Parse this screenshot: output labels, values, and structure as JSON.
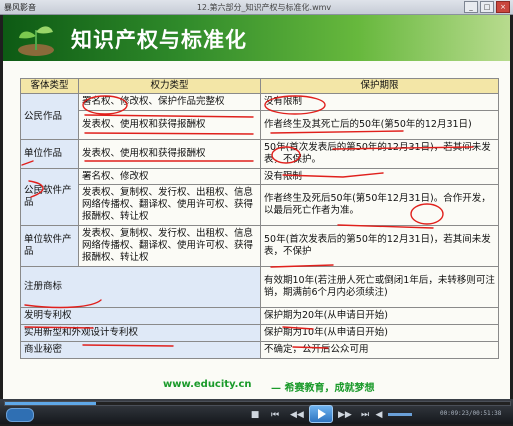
{
  "window": {
    "app_name": "暴风影音",
    "title": "12.第六部分_知识产权与标准化.wmv",
    "buttons": [
      "_",
      "□",
      "×"
    ]
  },
  "slide": {
    "title": "知识产权与标准化",
    "table": {
      "headers": [
        "客体类型",
        "权力类型",
        "保护期限"
      ],
      "rows": {
        "gongmin_1": {
          "type": "公民作品",
          "rights": "署名权、修改权、保护作品完整权",
          "term": "没有限制"
        },
        "gongmin_2": {
          "rights": "发表权、使用权和获得报酬权",
          "term": "作者终生及其死亡后的50年(第50年的12月31日)"
        },
        "danwei": {
          "type": "单位作品",
          "rights": "发表权、使用权和获得报酬权",
          "term": "50年(首次发表后的第50年的12月31日)，若其间未发表，不保护。"
        },
        "ruanjian_1": {
          "type": "公民软件产品",
          "rights": "署名权、修改权",
          "term": "没有限制"
        },
        "ruanjian_2": {
          "rights": "发表权、复制权、发行权、出租权、信息网络传播权、翻译权、使用许可权、获得报酬权、转让权",
          "term": "作者终生及死后50年(第50年12月31日)。合作开发，以最后死亡作者为准。"
        },
        "danwei_ruanjian": {
          "type": "单位软件产品",
          "rights": "发表权、复制权、发行权、出租权、信息网络传播权、翻译权、使用许可权、获得报酬权、转让权",
          "term": "50年(首次发表后的第50年的12月31日)，若其间未发表，不保护"
        },
        "shangbiao": {
          "type": "注册商标",
          "term": "有效期10年(若注册人死亡或倒闭1年后，未转移则可注销，期满前6个月内必须续注)"
        },
        "famming": {
          "type": "发明专利权",
          "term": "保护期为20年(从申请日开始)"
        },
        "shiyong": {
          "type": "实用新型和外观设计专利权",
          "term": "保护期为10年(从申请日开始)"
        },
        "mimi": {
          "type": "商业秘密",
          "term": "不确定，公开后公众可用"
        }
      }
    },
    "footer": {
      "url": "www.educity.cn",
      "slogan": "— 希赛教育，成就梦想"
    }
  },
  "player": {
    "time": "00:09:23/00:51:38",
    "progress_fraction": 0.18,
    "colors": {
      "accent": "#2f74c0",
      "ink": "#e0201c",
      "banner": "#2f8a2a"
    }
  }
}
